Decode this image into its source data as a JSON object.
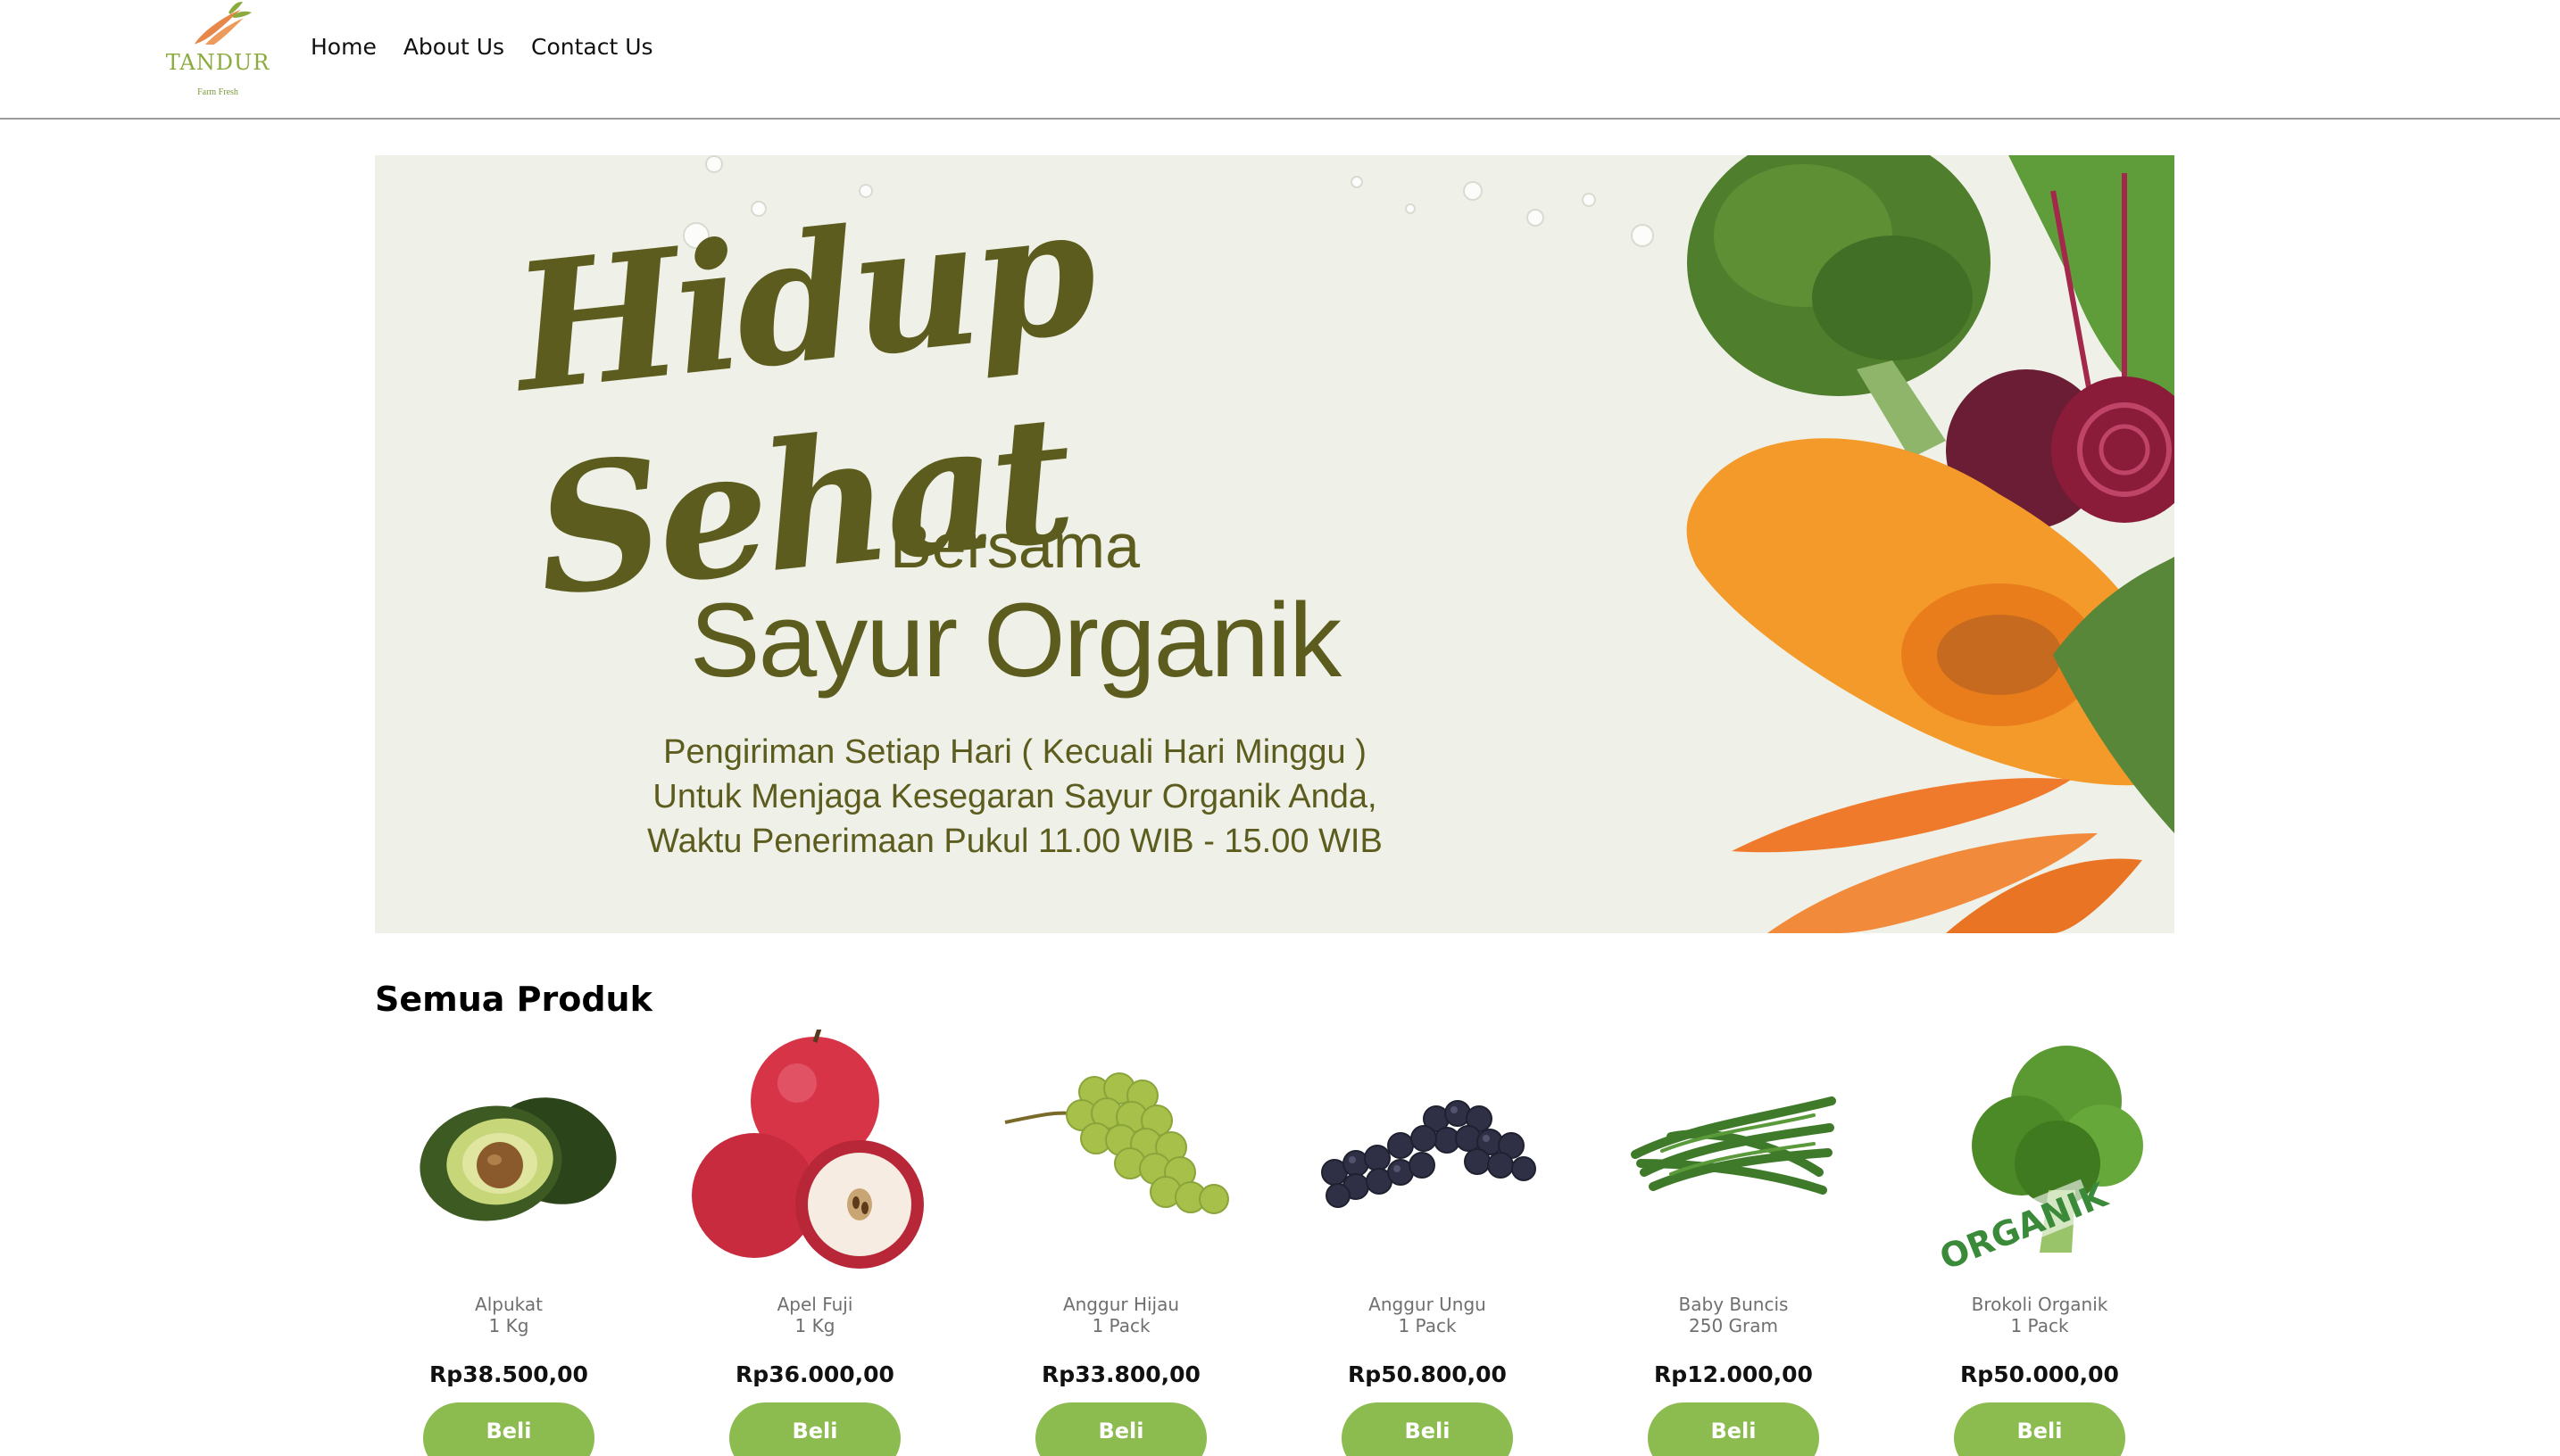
{
  "brand": {
    "name": "TANDUR",
    "tagline": "Farm Fresh"
  },
  "nav": {
    "items": [
      "Home",
      "About Us",
      "Contact Us"
    ]
  },
  "banner": {
    "title": "Hidup Sehat",
    "with": "Bersama",
    "subtitle": "Sayur Organik",
    "lines": [
      "Pengiriman Setiap Hari ( Kecuali Hari Minggu )",
      "Untuk Menjaga Kesegaran Sayur Organik Anda,",
      "Waktu Penerimaan Pukul 11.00 WIB - 15.00 WIB"
    ]
  },
  "products_section": {
    "title": "Semua Produk",
    "buy_label": "Beli",
    "items": [
      {
        "name": "Alpukat",
        "unit": "1 Kg",
        "price": "Rp38.500,00",
        "icon": "avocado-image"
      },
      {
        "name": "Apel Fuji",
        "unit": "1 Kg",
        "price": "Rp36.000,00",
        "icon": "apple-image"
      },
      {
        "name": "Anggur Hijau",
        "unit": "1 Pack",
        "price": "Rp33.800,00",
        "icon": "green-grapes-image"
      },
      {
        "name": "Anggur Ungu",
        "unit": "1 Pack",
        "price": "Rp50.800,00",
        "icon": "purple-grapes-image"
      },
      {
        "name": "Baby Buncis",
        "unit": "250 Gram",
        "price": "Rp12.000,00",
        "icon": "green-beans-image"
      },
      {
        "name": "Brokoli Organik",
        "unit": "1 Pack",
        "price": "Rp50.000,00",
        "icon": "broccoli-image",
        "stamp": "ORGANIK"
      }
    ]
  },
  "colors": {
    "accent_green": "#8cbb50",
    "banner_text": "#5c5c1e",
    "logo_green": "#8bab3e",
    "carrot_orange": "#e8874a"
  }
}
